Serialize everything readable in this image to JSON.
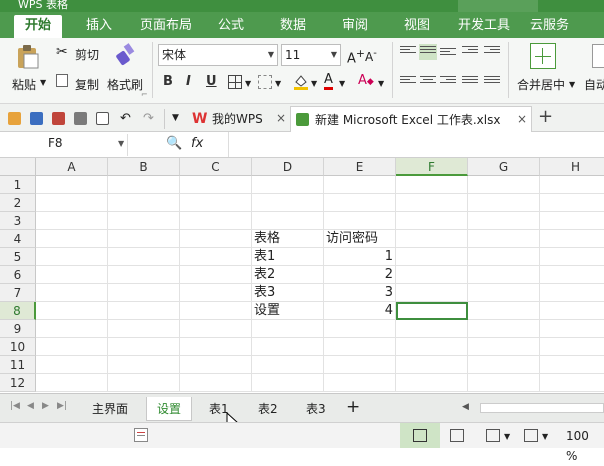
{
  "titlebar": {
    "app_name": "WPS 表格"
  },
  "ribbon_tabs": [
    "开始",
    "插入",
    "页面布局",
    "公式",
    "数据",
    "审阅",
    "视图",
    "开发工具",
    "云服务"
  ],
  "toolbar": {
    "paste": "粘贴",
    "cut": "剪切",
    "copy": "复制",
    "format_painter": "格式刷",
    "font_name": "宋体",
    "font_size": "11",
    "bold": "B",
    "italic": "I",
    "underline": "U",
    "merge_center": "合并居中",
    "auto_wrap": "自动"
  },
  "quickbar": {
    "my_wps": "我的WPS",
    "doc_tab": "新建 Microsoft Excel 工作表.xlsx",
    "add_tab": "+"
  },
  "formula_bar": {
    "cell_ref": "F8",
    "fx": "fx",
    "value": ""
  },
  "columns": [
    "A",
    "B",
    "C",
    "D",
    "E",
    "F",
    "G",
    "H"
  ],
  "rows": [
    "1",
    "2",
    "3",
    "4",
    "5",
    "6",
    "7",
    "8",
    "9",
    "10",
    "11",
    "12"
  ],
  "cells": {
    "D4": "表格",
    "E4": "访问密码",
    "D5": "表1",
    "E5": "1",
    "D6": "表2",
    "E6": "2",
    "D7": "表3",
    "E7": "3",
    "D8": "设置",
    "E8": "4"
  },
  "active_cell": "F8",
  "sheets": [
    "主界面",
    "设置",
    "表1",
    "表2",
    "表3"
  ],
  "active_sheet": "设置",
  "add_sheet": "+",
  "status": {
    "zoom": "100 %"
  },
  "colors": {
    "accent": "#4e9a4e",
    "active_sheet_text": "#2f8a2f"
  }
}
